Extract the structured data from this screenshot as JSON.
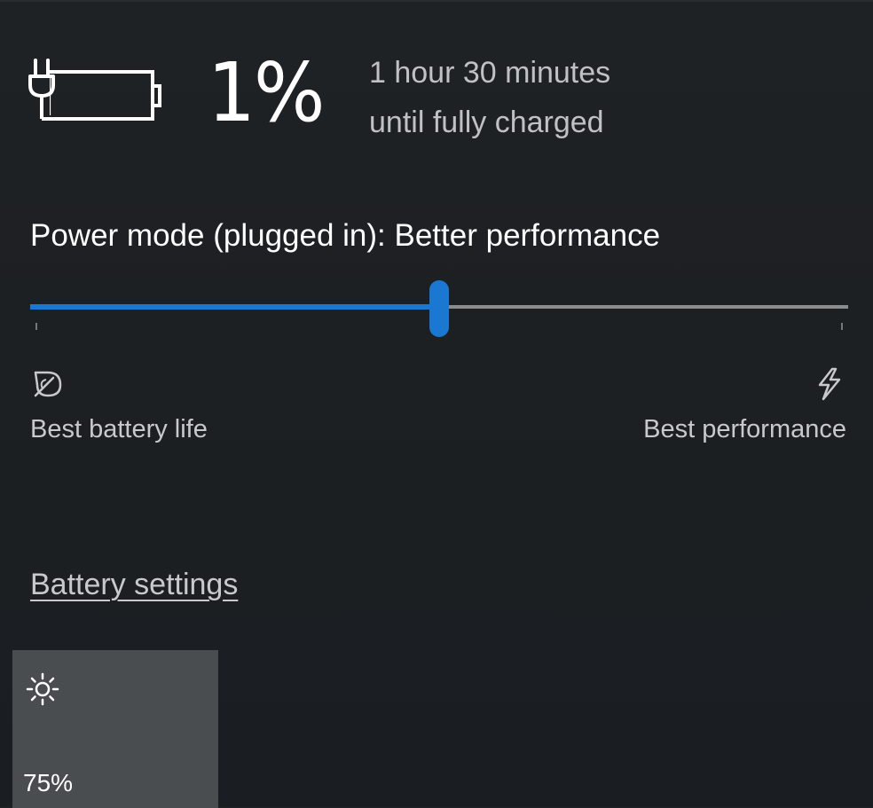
{
  "battery": {
    "icon": "battery-charging-icon",
    "percent": "1%",
    "level": 0.01,
    "status_line1": "1 hour 30 minutes",
    "status_line2": "until fully charged"
  },
  "power_mode": {
    "label": "Power mode (plugged in): Better performance",
    "slider_value_fraction": 0.5,
    "accent_color": "#1a78d2",
    "left_icon": "leaf-icon",
    "left_label": "Best battery life",
    "right_icon": "lightning-icon",
    "right_label": "Best performance"
  },
  "links": {
    "battery_settings": "Battery settings"
  },
  "brightness_tile": {
    "icon": "brightness-sun-icon",
    "value": "75%",
    "level": 0.75
  }
}
